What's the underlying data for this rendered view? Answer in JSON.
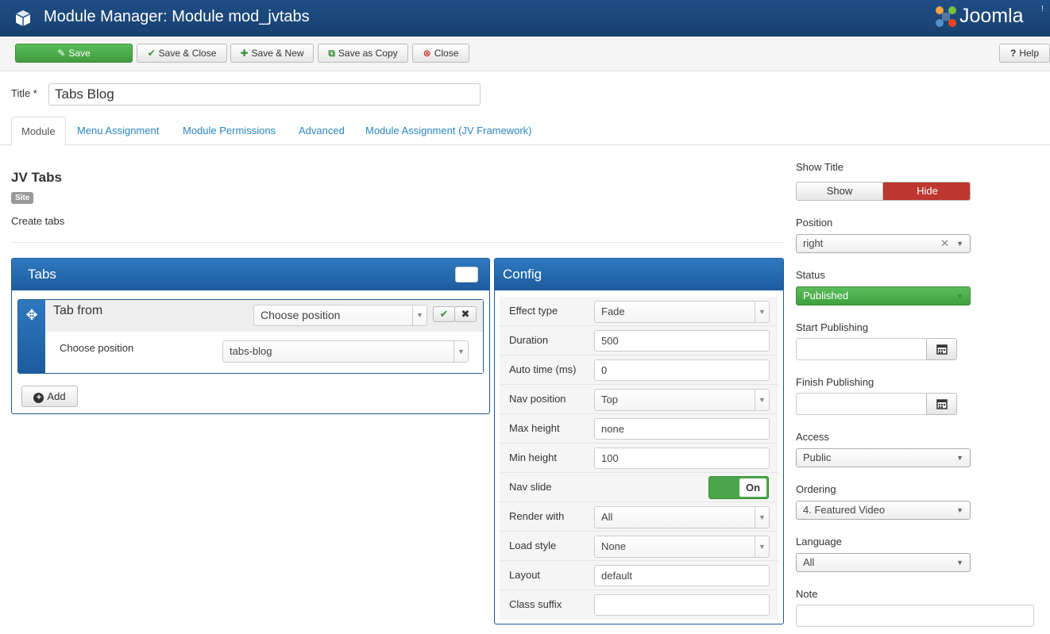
{
  "header": {
    "title": "Module Manager: Module mod_jvtabs",
    "logo_text": "Joomla",
    "logo_sup": "!"
  },
  "toolbar": {
    "save": "Save",
    "save_close": "Save & Close",
    "save_new": "Save & New",
    "save_copy": "Save as Copy",
    "close": "Close",
    "help": "Help"
  },
  "form": {
    "title_label": "Title *",
    "title_value": "Tabs Blog"
  },
  "tabs": [
    "Module",
    "Menu Assignment",
    "Module Permissions",
    "Advanced",
    "Module Assignment (JV Framework)"
  ],
  "module": {
    "name": "JV Tabs",
    "badge": "Site",
    "description": "Create tabs"
  },
  "tabs_panel": {
    "title": "Tabs",
    "item_title": "Tab from",
    "choose_placeholder": "Choose position",
    "body_label": "Choose position",
    "body_value": "tabs-blog",
    "add_label": "Add"
  },
  "config": {
    "title": "Config",
    "rows": [
      {
        "label": "Effect type",
        "value": "Fade"
      },
      {
        "label": "Duration",
        "value": "500"
      },
      {
        "label": "Auto time (ms)",
        "value": "0"
      },
      {
        "label": "Nav position",
        "value": "Top"
      },
      {
        "label": "Max height",
        "value": "none"
      },
      {
        "label": "Min height",
        "value": "100"
      },
      {
        "label": "Nav slide",
        "value": "On"
      },
      {
        "label": "Render with",
        "value": "All"
      },
      {
        "label": "Load style",
        "value": "None"
      },
      {
        "label": "Layout",
        "value": "default"
      },
      {
        "label": "Class suffix",
        "value": ""
      }
    ]
  },
  "sidebar": {
    "show_title_label": "Show Title",
    "show": "Show",
    "hide": "Hide",
    "position_label": "Position",
    "position_value": "right",
    "status_label": "Status",
    "status_value": "Published",
    "start_label": "Start Publishing",
    "finish_label": "Finish Publishing",
    "access_label": "Access",
    "access_value": "Public",
    "ordering_label": "Ordering",
    "ordering_value": "4. Featured Video",
    "language_label": "Language",
    "language_value": "All",
    "note_label": "Note"
  },
  "colors": {
    "header_bg": "#1f4d85",
    "save_green": "#4aa64a",
    "hide_red": "#bd362f",
    "panel_blue": "#2f78bf",
    "link_blue": "#2a86c1"
  }
}
